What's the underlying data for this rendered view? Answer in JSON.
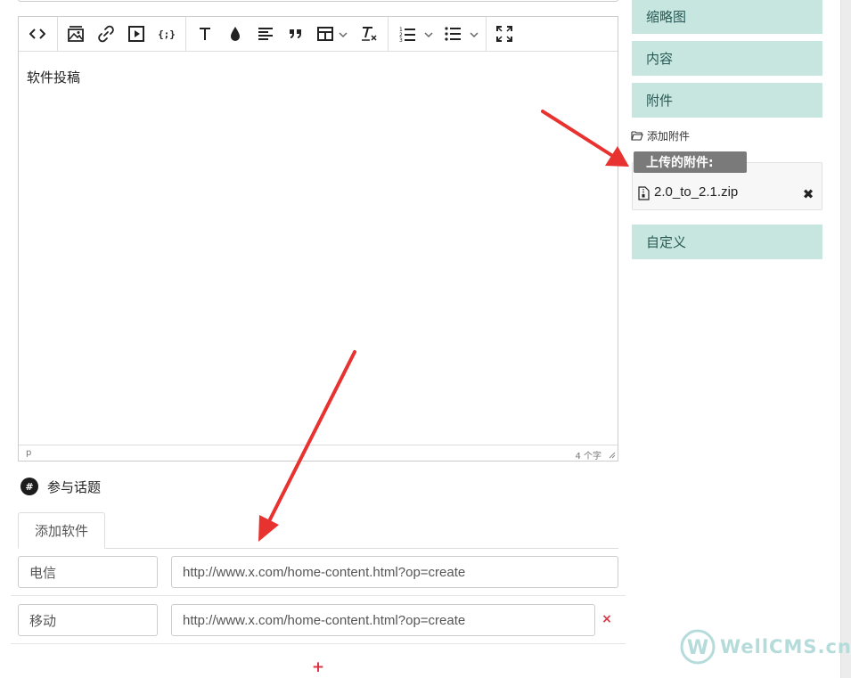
{
  "editor": {
    "content": "软件投稿",
    "status_path": "p",
    "word_count": "4 个字"
  },
  "toolbar": {
    "icons": [
      "code-view-icon",
      "image-icon",
      "link-icon",
      "media-icon",
      "code-sample-icon",
      "font-icon",
      "text-color-icon",
      "align-icon",
      "blockquote-icon",
      "table-icon",
      "clear-format-icon",
      "ordered-list-icon",
      "bullet-list-icon",
      "fullscreen-icon"
    ]
  },
  "topic": {
    "hash": "#",
    "label": "参与话题"
  },
  "software": {
    "tab_label": "添加软件",
    "rows": [
      {
        "name": "电信",
        "url": "http://www.x.com/home-content.html?op=create",
        "removable": false
      },
      {
        "name": "移动",
        "url": "http://www.x.com/home-content.html?op=create",
        "removable": true
      }
    ],
    "remove_symbol": "×",
    "add_symbol": "+"
  },
  "sidebar": {
    "thumbnail_label": "缩略图",
    "content_label": "内容",
    "attachment_label": "附件",
    "add_attachment_label": "添加附件",
    "uploaded_title": "上传的附件:",
    "files": [
      {
        "name": "2.0_to_2.1.zip"
      }
    ],
    "delete_symbol": "✖",
    "custom_label": "自定义"
  },
  "watermark": {
    "letter": "W",
    "text": "WellCMS.cn"
  },
  "colors": {
    "sidebar_button_bg": "#c8e6e0",
    "sidebar_button_text": "#285a55",
    "arrow": "#e8322f",
    "remove": "#dc3545",
    "uploaded_tag_bg": "#7a7a7a",
    "watermark": "#b5dcda"
  }
}
